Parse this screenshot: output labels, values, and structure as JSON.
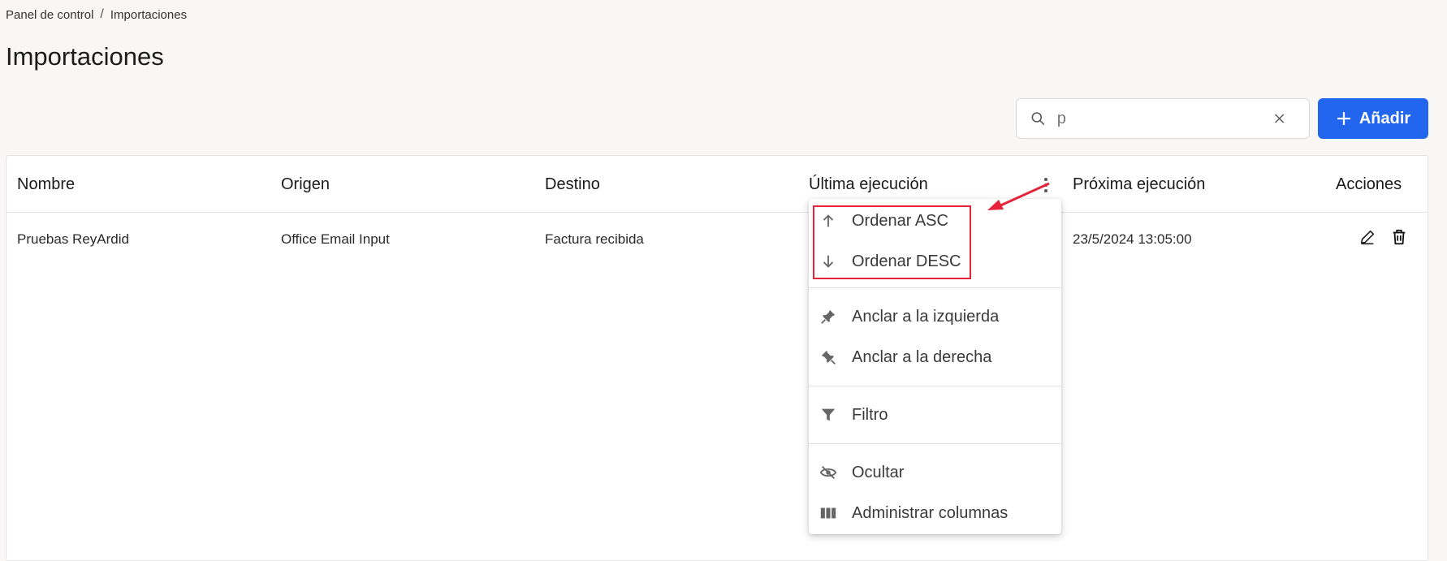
{
  "breadcrumb": {
    "home": "Panel de control",
    "separator": "/",
    "current": "Importaciones"
  },
  "page": {
    "title": "Importaciones"
  },
  "search": {
    "value": "p",
    "icon": "search-icon",
    "clear_icon": "close-icon"
  },
  "toolbar": {
    "add_label": "Añadir",
    "add_icon": "plus-icon",
    "accent": "#2266f0"
  },
  "table": {
    "columns": [
      "Nombre",
      "Origen",
      "Destino",
      "Última ejecución",
      "Próxima ejecución",
      "Acciones"
    ],
    "rows": [
      {
        "nombre": "Pruebas ReyArdid",
        "origen": "Office Email Input",
        "destino": "Factura recibida",
        "ultima": "",
        "proxima": "23/5/2024 13:05:00"
      }
    ]
  },
  "column_menu": {
    "items": [
      {
        "label": "Ordenar ASC",
        "icon": "arrow-up-icon"
      },
      {
        "label": "Ordenar DESC",
        "icon": "arrow-down-icon"
      },
      {
        "label": "Anclar a la izquierda",
        "icon": "pin-left-icon"
      },
      {
        "label": "Anclar a la derecha",
        "icon": "pin-right-icon"
      },
      {
        "label": "Filtro",
        "icon": "filter-icon"
      },
      {
        "label": "Ocultar",
        "icon": "eye-off-icon"
      },
      {
        "label": "Administrar columnas",
        "icon": "columns-icon"
      }
    ]
  },
  "annotation": {
    "color": "#e5243b"
  }
}
